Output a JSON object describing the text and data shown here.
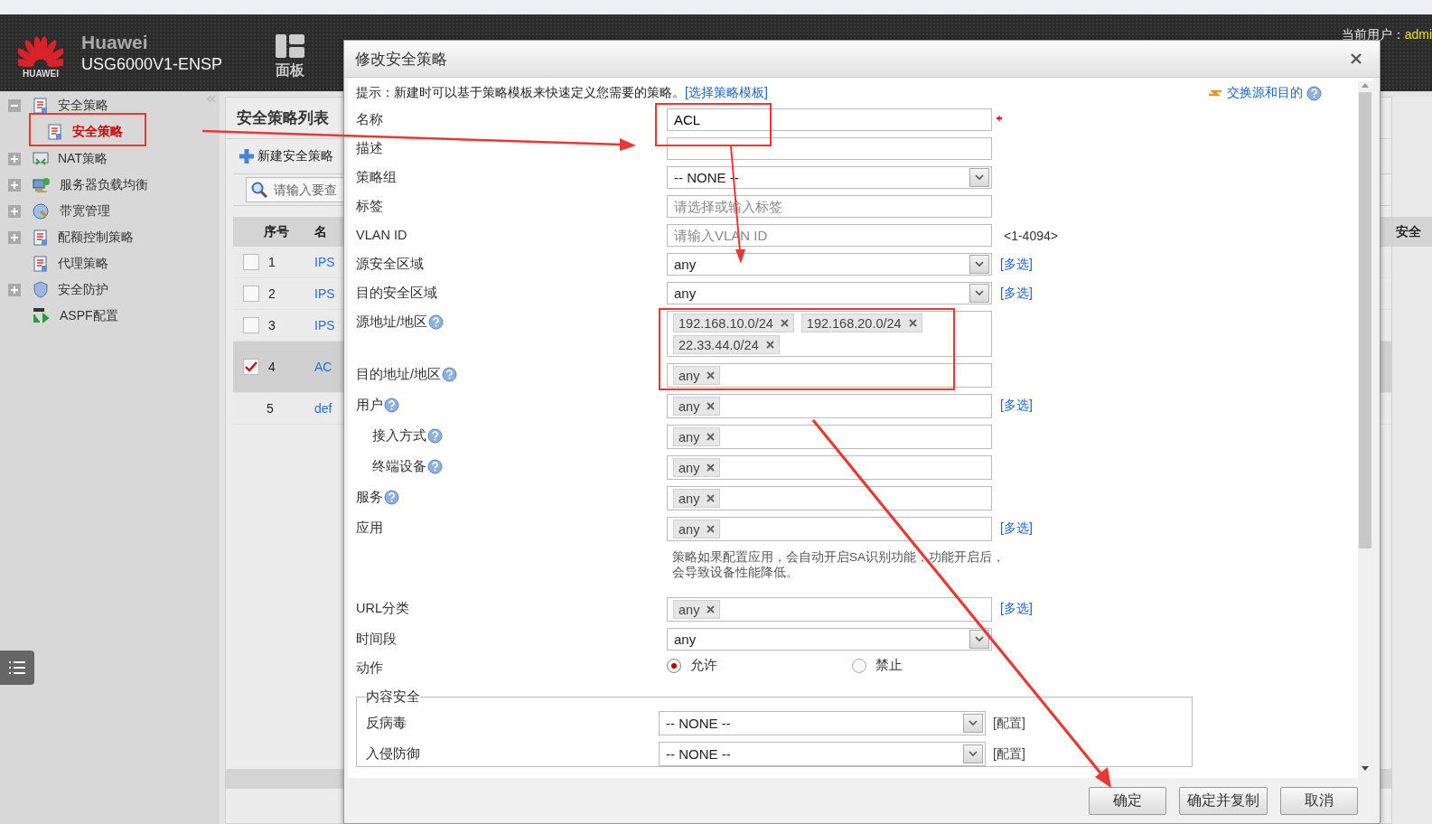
{
  "header": {
    "logo_text": "HUAWEI",
    "brand": "Huawei",
    "model": "USG6000V1-ENSP",
    "nav": [
      {
        "label": "面板"
      }
    ],
    "user_label": "当前用户：",
    "user": "admi"
  },
  "sidebar": {
    "items": [
      {
        "label": "安全策略",
        "kind": "group",
        "expanded": true,
        "children": [
          {
            "label": "安全策略",
            "selected": true
          }
        ]
      },
      {
        "label": "NAT策略",
        "kind": "group",
        "expanded": false
      },
      {
        "label": "服务器负载均衡",
        "kind": "group",
        "expanded": false
      },
      {
        "label": "带宽管理",
        "kind": "group",
        "expanded": false
      },
      {
        "label": "配额控制策略",
        "kind": "group",
        "expanded": false
      },
      {
        "label": "代理策略",
        "kind": "leaf"
      },
      {
        "label": "安全防护",
        "kind": "group",
        "expanded": false
      },
      {
        "label": "ASPF配置",
        "kind": "leaf"
      }
    ]
  },
  "list_panel": {
    "title": "安全策略列表",
    "new_button": "新建安全策略",
    "search": {
      "placeholder": "请输入要查"
    },
    "columns": [
      "序号",
      "名"
    ],
    "rows": [
      {
        "index": "1",
        "name": "IPS",
        "kind": "policy",
        "checked": false,
        "selected": false
      },
      {
        "index": "2",
        "name": "IPS",
        "kind": "policy",
        "checked": false,
        "selected": false
      },
      {
        "index": "3",
        "name": "IPS",
        "kind": "policy",
        "checked": false,
        "selected": false
      },
      {
        "index": "4",
        "name": "AC",
        "kind": "policy",
        "checked": true,
        "selected": true
      },
      {
        "index": "5",
        "name": "def",
        "kind": "default",
        "selected": false
      }
    ]
  },
  "right_column": {
    "header": "安全"
  },
  "dialog": {
    "title": "修改安全策略",
    "hint": "提示：新建时可以基于策略模板来快速定义您需要的策略。",
    "template_link": "[选择策略模板]",
    "swap_link": "交换源和目的",
    "fields": [
      {
        "label": "名称",
        "kind": "text",
        "value": "ACL",
        "required": true,
        "help": false
      },
      {
        "label": "描述",
        "kind": "text",
        "required": false,
        "help": false
      },
      {
        "label": "策略组",
        "kind": "select",
        "value": "-- NONE --",
        "required": false,
        "help": false
      },
      {
        "label": "标签",
        "kind": "text",
        "placeholder": "请选择或输入标签",
        "required": false,
        "help": false
      },
      {
        "label": "VLAN ID",
        "kind": "text",
        "placeholder": "请输入VLAN ID",
        "suffix": "<1-4094>",
        "required": false,
        "help": false
      },
      {
        "label": "源安全区域",
        "kind": "select",
        "value": "any",
        "link": "[多选]",
        "required": false,
        "help": false
      },
      {
        "label": "目的安全区域",
        "kind": "select",
        "value": "any",
        "link": "[多选]",
        "required": false,
        "help": false
      },
      {
        "label": "源地址/地区",
        "kind": "tags",
        "tags": [
          "192.168.10.0/24",
          "192.168.20.0/24",
          "22.33.44.0/24"
        ],
        "required": false,
        "help": true
      },
      {
        "label": "目的地址/地区",
        "kind": "tags",
        "tags": [
          "any"
        ],
        "required": false,
        "help": true
      },
      {
        "label": "用户",
        "kind": "tags",
        "tags": [
          "any"
        ],
        "link": "[多选]",
        "required": false,
        "help": true,
        "children": [
          {
            "label": "接入方式",
            "kind": "tags",
            "tags": [
              "any"
            ],
            "required": false,
            "help": true
          },
          {
            "label": "终端设备",
            "kind": "tags",
            "tags": [
              "any"
            ],
            "required": false,
            "help": true
          }
        ]
      },
      {
        "label": "服务",
        "kind": "tags",
        "tags": [
          "any"
        ],
        "required": false,
        "help": true
      },
      {
        "label": "应用",
        "kind": "tags",
        "tags": [
          "any"
        ],
        "link": "[多选]",
        "note": "策略如果配置应用，会自动开启SA识别功能，功能开启后，会导致设备性能降低。",
        "required": false,
        "help": false
      },
      {
        "label": "URL分类",
        "kind": "tags",
        "tags": [
          "any"
        ],
        "link": "[多选]",
        "required": false,
        "help": false
      },
      {
        "label": "时间段",
        "kind": "select",
        "value": "any",
        "required": false,
        "help": false
      }
    ],
    "action": {
      "label": "动作",
      "options": [
        {
          "label": "允许",
          "selected": true
        },
        {
          "label": "禁止",
          "selected": false
        }
      ]
    },
    "content_security": {
      "legend": "内容安全",
      "rows": [
        {
          "label": "反病毒",
          "value": "-- NONE --",
          "link": "[配置]"
        },
        {
          "label": "入侵防御",
          "value": "-- NONE --",
          "link": "[配置]"
        }
      ]
    },
    "buttons": [
      "确定",
      "确定并复制",
      "取消"
    ]
  }
}
